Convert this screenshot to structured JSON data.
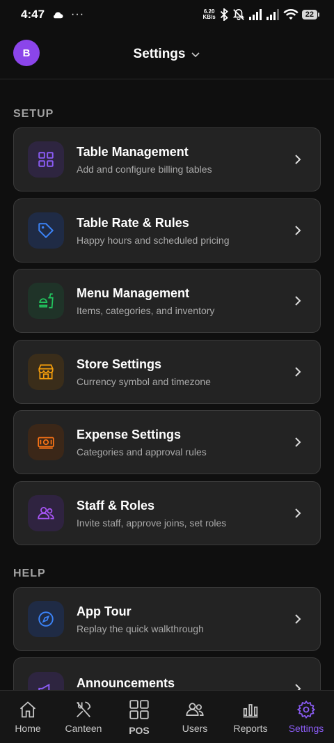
{
  "status": {
    "time": "4:47",
    "net_speed_value": "6.20",
    "net_speed_unit": "KB/s",
    "battery": "22"
  },
  "header": {
    "avatar_initial": "B",
    "title": "Settings"
  },
  "sections": {
    "setup_label": "SETUP",
    "help_label": "HELP"
  },
  "setup_items": [
    {
      "title": "Table Management",
      "subtitle": "Add and configure billing tables",
      "icon": "grid-icon",
      "color": "#8b5cf6"
    },
    {
      "title": "Table Rate & Rules",
      "subtitle": "Happy hours and scheduled pricing",
      "icon": "tag-icon",
      "color": "#3b82f6"
    },
    {
      "title": "Menu Management",
      "subtitle": "Items, categories, and inventory",
      "icon": "fast-food-icon",
      "color": "#22c55e"
    },
    {
      "title": "Store Settings",
      "subtitle": "Currency symbol and timezone",
      "icon": "store-icon",
      "color": "#f59e0b"
    },
    {
      "title": "Expense Settings",
      "subtitle": "Categories and approval rules",
      "icon": "banknote-icon",
      "color": "#f97316"
    },
    {
      "title": "Staff & Roles",
      "subtitle": "Invite staff, approve joins, set roles",
      "icon": "users-icon",
      "color": "#a855f7"
    }
  ],
  "help_items": [
    {
      "title": "App Tour",
      "subtitle": "Replay the quick walkthrough",
      "icon": "compass-icon",
      "color": "#3b82f6"
    },
    {
      "title": "Announcements",
      "subtitle": "",
      "icon": "megaphone-icon",
      "color": "#8b5cf6"
    }
  ],
  "nav": [
    {
      "label": "Home",
      "icon": "home-icon"
    },
    {
      "label": "Canteen",
      "icon": "utensils-icon"
    },
    {
      "label": "POS",
      "icon": "pos-grid-icon"
    },
    {
      "label": "Users",
      "icon": "users-icon"
    },
    {
      "label": "Reports",
      "icon": "bar-chart-icon"
    },
    {
      "label": "Settings",
      "icon": "gear-icon",
      "active": true
    }
  ],
  "colors": {
    "accent": "#8b5cf6",
    "avatar": "#8b45ea",
    "card_bg": "#232323",
    "page_bg": "#0f0f0f"
  }
}
